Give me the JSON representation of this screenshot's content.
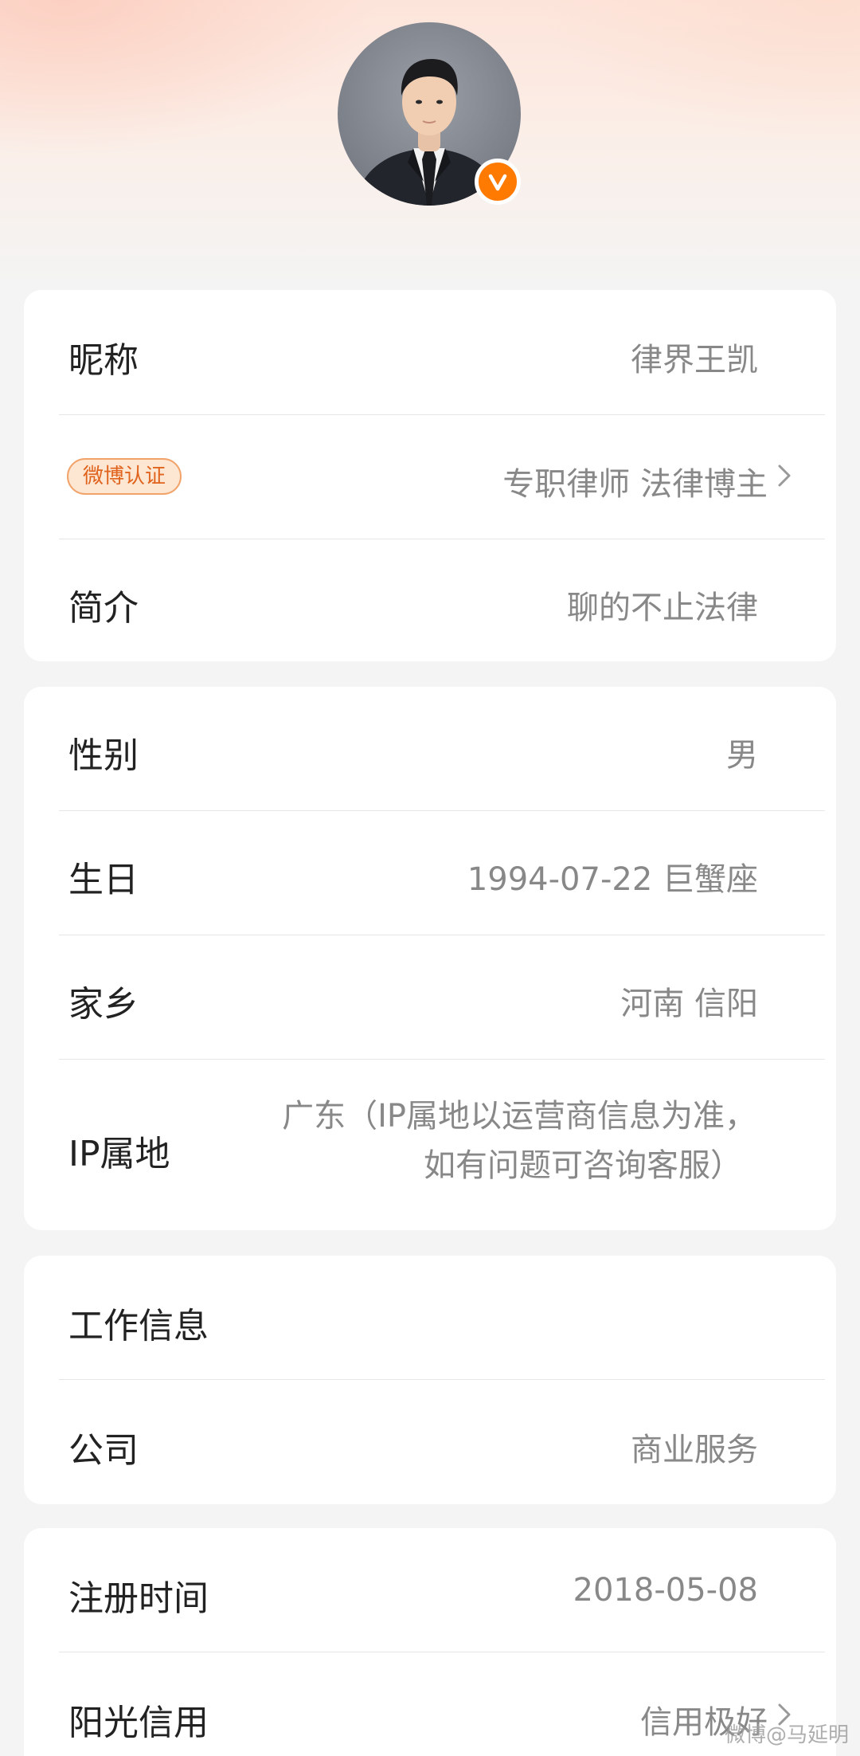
{
  "profile": {
    "avatar_alt": "头像",
    "verified_icon": "v-verified-icon"
  },
  "basic": {
    "nickname_label": "昵称",
    "nickname_value": "律界王凯",
    "cert_badge": "微博认证",
    "cert_value": "专职律师 法律博主",
    "intro_label": "简介",
    "intro_value": "聊的不止法律"
  },
  "personal": {
    "gender_label": "性别",
    "gender_value": "男",
    "birthday_label": "生日",
    "birthday_value": "1994-07-22 巨蟹座",
    "hometown_label": "家乡",
    "hometown_value": "河南 信阳",
    "ip_label": "IP属地",
    "ip_value_line1": "广东（IP属地以运营商信息为准，",
    "ip_value_line2": "如有问题可咨询客服）"
  },
  "work": {
    "section_label": "工作信息",
    "company_label": "公司",
    "company_value": "商业服务"
  },
  "account": {
    "register_label": "注册时间",
    "register_value": "2018-05-08",
    "credit_label": "阳光信用",
    "credit_value": "信用极好"
  },
  "watermark": "微博@马延明",
  "colors": {
    "accent": "#ff7a00",
    "badge_text": "#e0641e",
    "badge_bg": "#fde6d2",
    "label": "#222222",
    "value": "#888888"
  }
}
